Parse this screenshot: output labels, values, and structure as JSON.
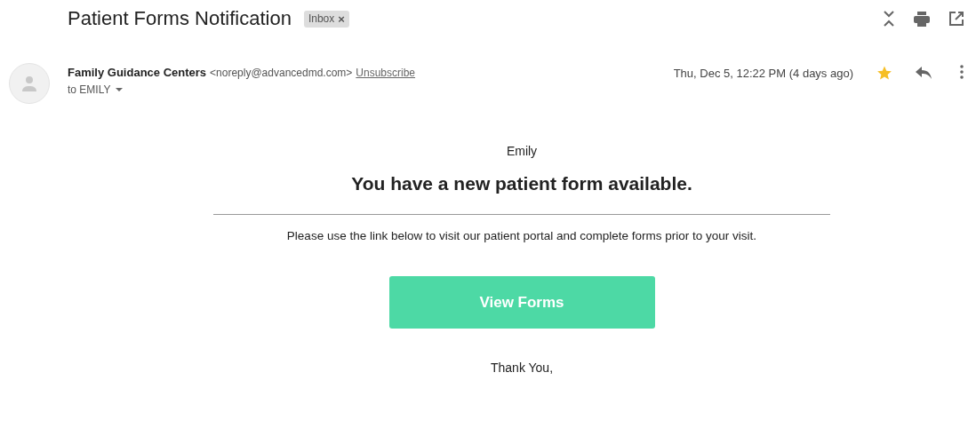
{
  "subject": "Patient Forms Notification",
  "label": {
    "text": "Inbox",
    "remove": "×"
  },
  "sender": {
    "name": "Family Guidance Centers",
    "address": "<noreply@advancedmd.com>",
    "unsubscribe": "Unsubscribe",
    "to": "to EMILY",
    "date": "Thu, Dec 5, 12:22 PM (4 days ago)",
    "starred": true
  },
  "body": {
    "greeting": "Emily",
    "heading": "You have a new patient form available.",
    "text": "Please use the link below to visit our patient portal and complete forms prior to your visit.",
    "button": "View Forms",
    "closing": "Thank You,"
  }
}
